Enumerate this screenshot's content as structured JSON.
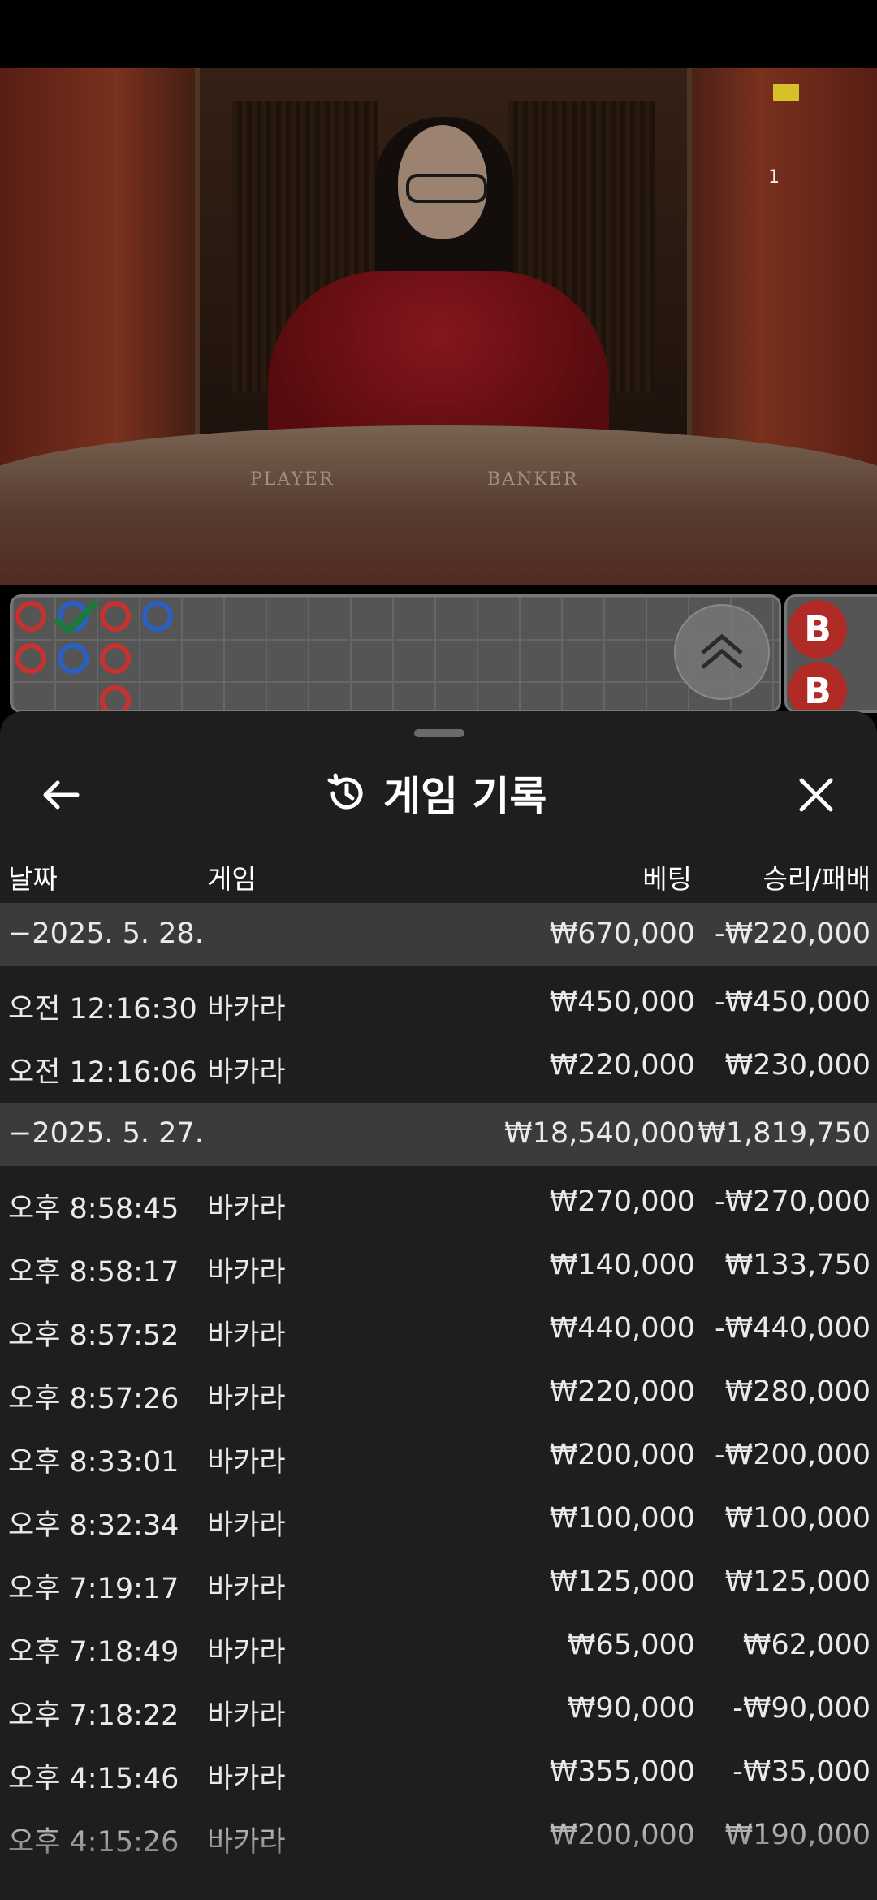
{
  "video": {
    "table_player_label": "PLAYER",
    "table_banker_label": "BANKER",
    "corner_number": "1"
  },
  "roadmap": {
    "right_dots": [
      "B",
      "B"
    ]
  },
  "sheet": {
    "title": "게임 기록",
    "columns": {
      "date": "날짜",
      "game": "게임",
      "bet": "베팅",
      "winloss": "승리/패배"
    }
  },
  "records": [
    {
      "type": "group",
      "date": "−2025. 5. 28.",
      "game": "",
      "bet": "₩670,000",
      "winloss": "-₩220,000"
    },
    {
      "type": "item",
      "date": "오전 12:16:30",
      "game": "바카라",
      "bet": "₩450,000",
      "winloss": "-₩450,000"
    },
    {
      "type": "item",
      "date": "오전 12:16:06",
      "game": "바카라",
      "bet": "₩220,000",
      "winloss": "₩230,000"
    },
    {
      "type": "group",
      "date": "−2025. 5. 27.",
      "game": "",
      "bet": "₩18,540,000",
      "winloss": "₩1,819,750"
    },
    {
      "type": "item",
      "date": "오후 8:58:45",
      "game": "바카라",
      "bet": "₩270,000",
      "winloss": "-₩270,000"
    },
    {
      "type": "item",
      "date": "오후 8:58:17",
      "game": "바카라",
      "bet": "₩140,000",
      "winloss": "₩133,750"
    },
    {
      "type": "item",
      "date": "오후 8:57:52",
      "game": "바카라",
      "bet": "₩440,000",
      "winloss": "-₩440,000"
    },
    {
      "type": "item",
      "date": "오후 8:57:26",
      "game": "바카라",
      "bet": "₩220,000",
      "winloss": "₩280,000"
    },
    {
      "type": "item",
      "date": "오후 8:33:01",
      "game": "바카라",
      "bet": "₩200,000",
      "winloss": "-₩200,000"
    },
    {
      "type": "item",
      "date": "오후 8:32:34",
      "game": "바카라",
      "bet": "₩100,000",
      "winloss": "₩100,000"
    },
    {
      "type": "item",
      "date": "오후 7:19:17",
      "game": "바카라",
      "bet": "₩125,000",
      "winloss": "₩125,000"
    },
    {
      "type": "item",
      "date": "오후 7:18:49",
      "game": "바카라",
      "bet": "₩65,000",
      "winloss": "₩62,000"
    },
    {
      "type": "item",
      "date": "오후 7:18:22",
      "game": "바카라",
      "bet": "₩90,000",
      "winloss": "-₩90,000"
    },
    {
      "type": "item",
      "date": "오후 4:15:46",
      "game": "바카라",
      "bet": "₩355,000",
      "winloss": "-₩35,000"
    },
    {
      "type": "item",
      "date": "오후 4:15:26",
      "game": "바카라",
      "bet": "₩200,000",
      "winloss": "₩190,000"
    }
  ],
  "icons": {
    "back": "arrow-left-icon",
    "history": "history-icon",
    "close": "close-icon",
    "expand": "double-chevron-up-icon"
  }
}
